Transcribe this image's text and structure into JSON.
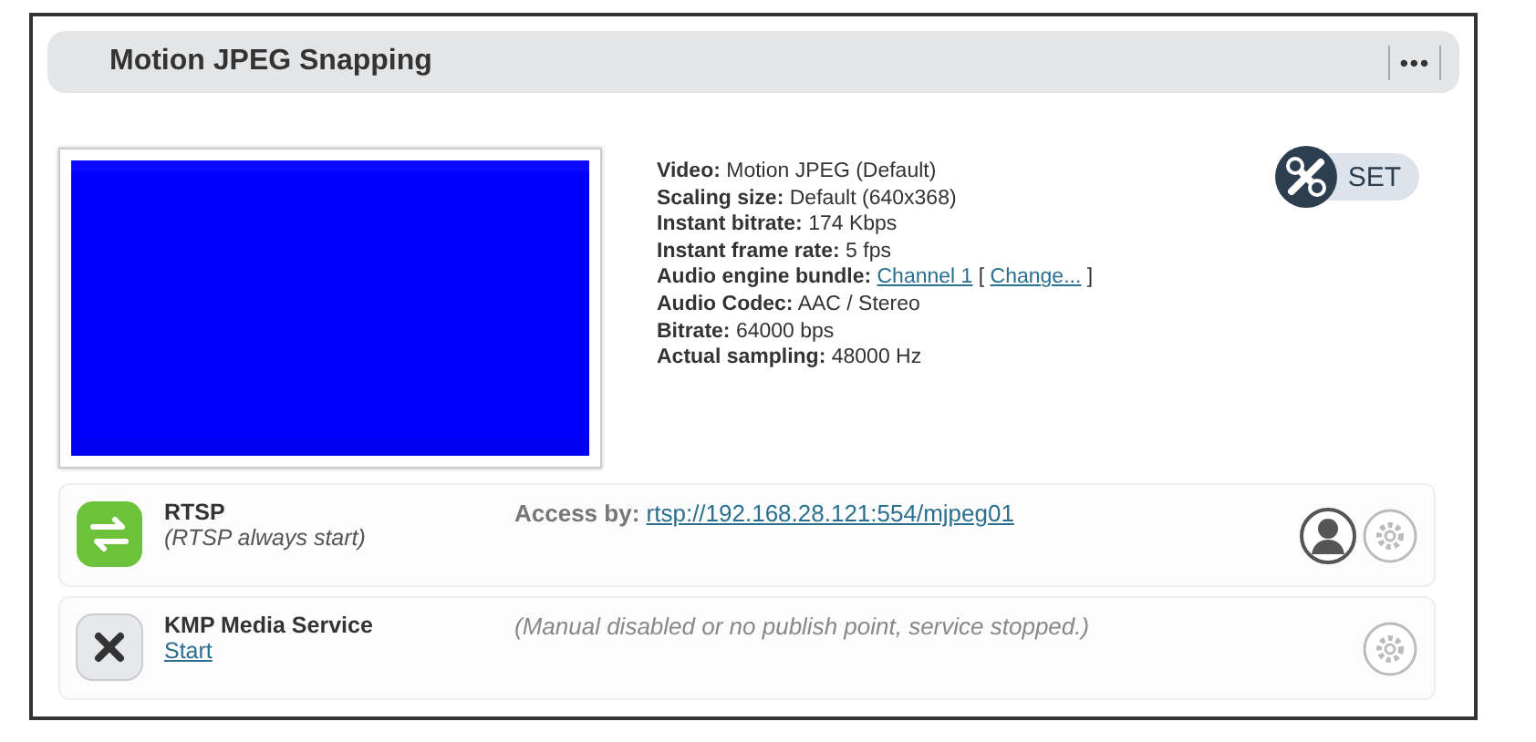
{
  "panel": {
    "title": "Motion JPEG Snapping",
    "menu": "•••"
  },
  "set_button": {
    "label": "SET"
  },
  "info": [
    {
      "label": "Video:",
      "parts": [
        {
          "kind": "text",
          "text": "Motion JPEG (Default)"
        }
      ]
    },
    {
      "label": "Scaling size:",
      "parts": [
        {
          "kind": "text",
          "text": "Default (640x368)"
        }
      ]
    },
    {
      "label": "Instant bitrate:",
      "parts": [
        {
          "kind": "text",
          "text": "174 Kbps"
        }
      ]
    },
    {
      "label": "Instant frame rate:",
      "parts": [
        {
          "kind": "text",
          "text": "5 fps"
        }
      ]
    },
    {
      "label": "Audio engine bundle:",
      "parts": [
        {
          "kind": "link",
          "text": "Channel 1"
        },
        {
          "kind": "text",
          "text": "["
        },
        {
          "kind": "link",
          "text": "Change..."
        },
        {
          "kind": "text",
          "text": "]"
        }
      ]
    },
    {
      "label": "Audio Codec:",
      "parts": [
        {
          "kind": "text",
          "text": "AAC / Stereo"
        }
      ]
    },
    {
      "label": "Bitrate:",
      "parts": [
        {
          "kind": "text",
          "text": "64000 bps"
        }
      ]
    },
    {
      "label": "Actual sampling:",
      "parts": [
        {
          "kind": "text",
          "text": "48000 Hz"
        }
      ]
    }
  ],
  "services": [
    {
      "name": "RTSP",
      "kind": "running",
      "sub": {
        "kind": "note",
        "text": "(RTSP always start)"
      },
      "detail": {
        "kind": "access",
        "label": "Access by:",
        "link": "rtsp://192.168.28.121:554/mjpeg01"
      },
      "user_icon": true
    },
    {
      "name": "KMP Media Service",
      "kind": "stopped",
      "sub": {
        "kind": "link",
        "text": "Start"
      },
      "detail": {
        "kind": "message",
        "text": "(Manual disabled or no publish point, service stopped.)"
      },
      "user_icon": false
    }
  ]
}
